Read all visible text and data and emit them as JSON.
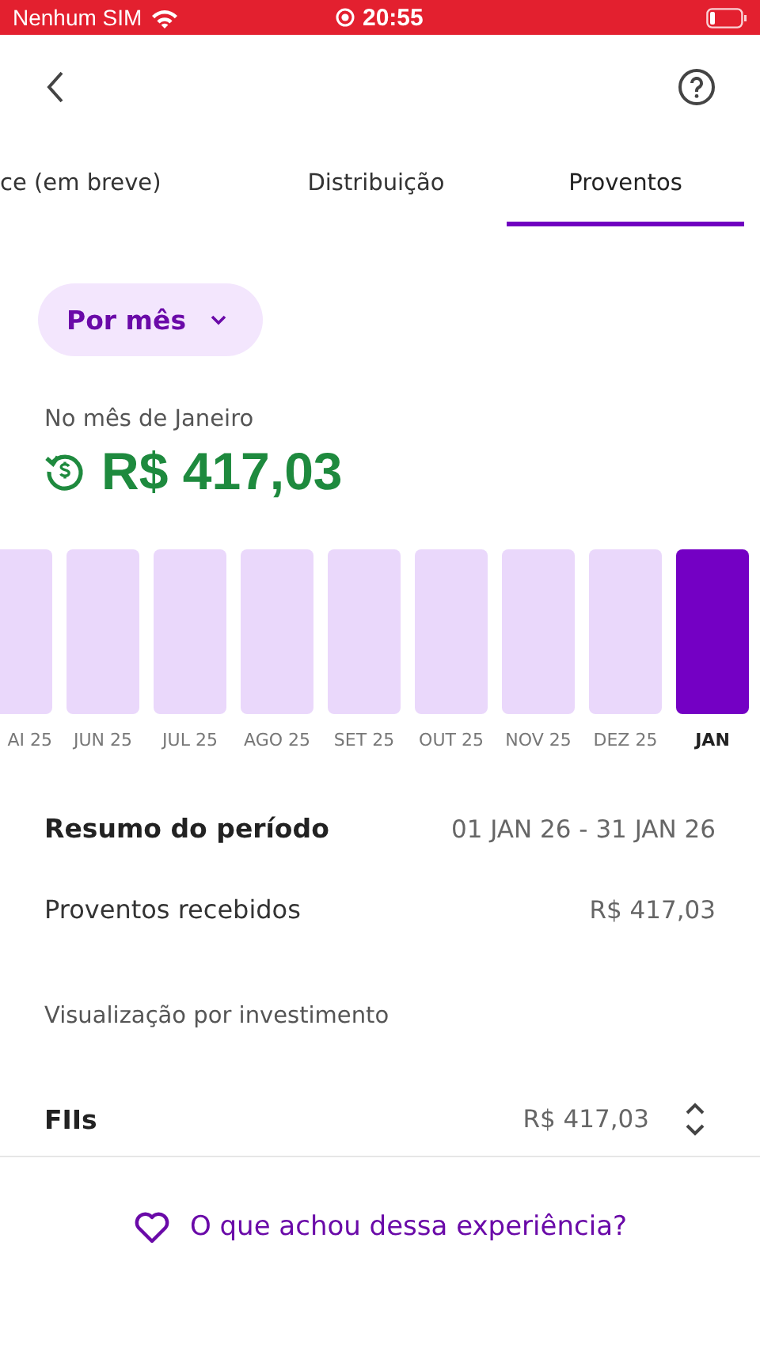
{
  "status_bar": {
    "carrier": "Nenhum SIM",
    "time": "20:55"
  },
  "tabs": [
    {
      "label": "ce (em breve)",
      "selected": false
    },
    {
      "label": "Distribuição",
      "selected": false
    },
    {
      "label": "Proventos",
      "selected": true
    }
  ],
  "period_filter": {
    "label": "Por mês"
  },
  "month_summary": {
    "caption": "No mês de Janeiro",
    "amount": "R$ 417,03"
  },
  "months": [
    {
      "label": "AI 25",
      "selected": false
    },
    {
      "label": "JUN 25",
      "selected": false
    },
    {
      "label": "JUL 25",
      "selected": false
    },
    {
      "label": "AGO 25",
      "selected": false
    },
    {
      "label": "SET 25",
      "selected": false
    },
    {
      "label": "OUT 25",
      "selected": false
    },
    {
      "label": "NOV 25",
      "selected": false
    },
    {
      "label": "DEZ 25",
      "selected": false
    },
    {
      "label": "JAN",
      "selected": true
    }
  ],
  "period_summary": {
    "title": "Resumo do período",
    "range": "01 JAN 26 - 31 JAN 26",
    "received_label": "Proventos recebidos",
    "received_value": "R$ 417,03"
  },
  "by_investment": {
    "title": "Visualização por investimento",
    "rows": [
      {
        "name": "FIIs",
        "value": "R$ 417,03"
      }
    ]
  },
  "feedback": {
    "label": "O que achou dessa experiência?"
  }
}
